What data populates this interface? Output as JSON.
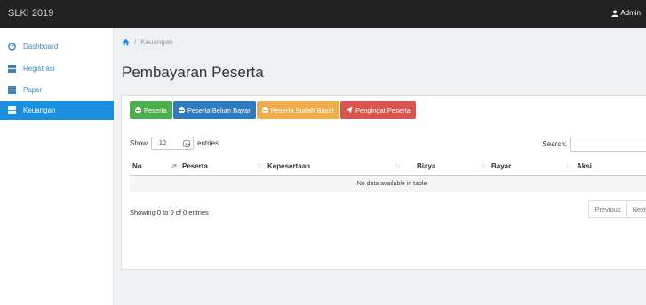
{
  "topbar": {
    "brand": "SLKI 2019",
    "user": "Admin"
  },
  "sidebar": {
    "items": [
      {
        "label": "Dashboard",
        "icon": "dashboard-icon",
        "active": false
      },
      {
        "label": "Registrasi",
        "icon": "grid-icon",
        "active": false
      },
      {
        "label": "Paper",
        "icon": "grid-icon",
        "active": false
      },
      {
        "label": "Keuangan",
        "icon": "grid-icon",
        "active": true
      }
    ]
  },
  "breadcrumb": {
    "separator": "/",
    "current": "Keuangan"
  },
  "page": {
    "title": "Pembayaran Peserta"
  },
  "buttons": {
    "peserta": "Peserta",
    "belum_bayar": "Peserta Belum Bayar",
    "sudah_bayar": "Peserta Sudah Bayar",
    "pengingat": "Pengingat Peserta"
  },
  "table_controls": {
    "show_label": "Show",
    "entries_value": "10",
    "entries_label": "entries",
    "search_label": "Search:"
  },
  "table": {
    "columns": [
      "No",
      "Peserta",
      "Kepesertaan",
      "Biaya",
      "Bayar",
      "Aksi"
    ],
    "empty_message": "No data available in table"
  },
  "footer": {
    "info": "Showing 0 to 0 of 0 entries",
    "previous": "Previous",
    "next": "Next"
  },
  "colors": {
    "topbar": "#222222",
    "active_sidebar": "#1a8fe0",
    "btn_green": "#4cae4c",
    "btn_blue": "#2f7bbd",
    "btn_orange": "#f0ad4e",
    "btn_red": "#d9534f"
  }
}
